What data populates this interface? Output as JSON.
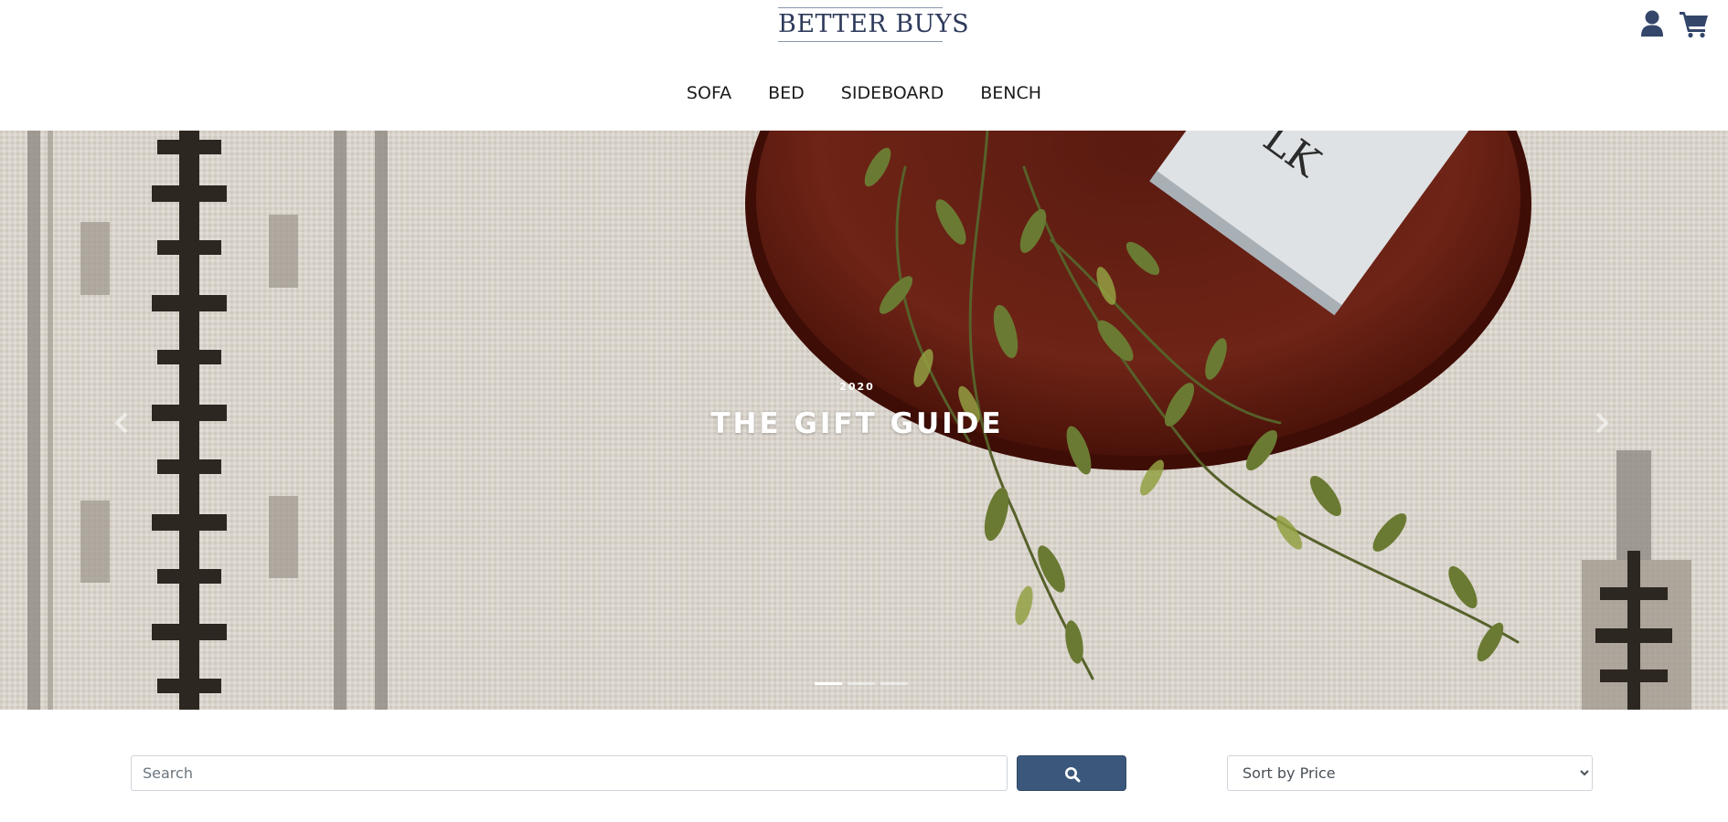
{
  "brand": {
    "logo_text": "BETTER BUYS"
  },
  "header": {
    "icons": {
      "account": "user-icon",
      "cart": "cart-icon"
    }
  },
  "nav": {
    "items": [
      {
        "label": "SOFA"
      },
      {
        "label": "BED"
      },
      {
        "label": "SIDEBOARD"
      },
      {
        "label": "BENCH"
      }
    ]
  },
  "hero": {
    "eyebrow": "2020",
    "title": "THE GIFT GUIDE",
    "slide_count": 3,
    "active_slide": 1,
    "icons": {
      "prev": "chevron-left-icon",
      "next": "chevron-right-icon"
    }
  },
  "toolbar": {
    "search_placeholder": "Search",
    "search_value": "",
    "search_button_icon": "search-icon",
    "sort_selected": "Sort by Price"
  },
  "colors": {
    "brand_navy": "#2f3b5c",
    "button_blue": "#3b587c",
    "hero_rug": "#d8d3cb",
    "tray_wood": "#6a1f14"
  }
}
